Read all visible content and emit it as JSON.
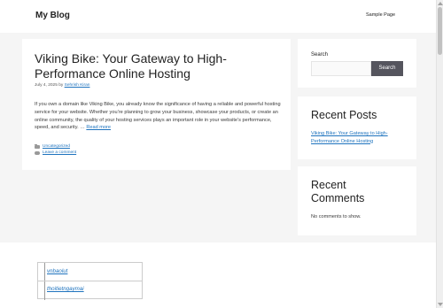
{
  "header": {
    "site_title": "My Blog",
    "nav_items": [
      "Sample Page"
    ]
  },
  "post": {
    "title": "Viking Bike: Your Gateway to High-Performance Online Hosting",
    "date": "July 4, 2025",
    "by": "by",
    "author": "Sehrish Kiran",
    "excerpt": "If you own a domain like Viking Bike, you already know the significance of having a reliable and powerful hosting service for your website. Whether you’re planning to grow your business, showcase your products, or create an online community, the quality of your hosting services plays an important role in your website’s performance, speed, and security. …",
    "read_more": "Read more",
    "category": "Uncategorized",
    "comment_link": "Leave a comment"
  },
  "sidebar": {
    "search_label": "Search",
    "search_value": "",
    "search_button": "Search",
    "recent_posts_title": "Recent Posts",
    "recent_posts": [
      "Viking Bike: Your Gateway to High-Performance Online Hosting"
    ],
    "recent_comments_title": "Recent Comments",
    "no_comments": "No comments to show."
  },
  "footer": {
    "links": [
      "vnbaolut",
      "thoitietngaymai"
    ]
  },
  "icons": {
    "category": "folder-icon",
    "comments": "comment-icon"
  },
  "colors": {
    "link": "#1e73be",
    "search_button_bg": "#55555e",
    "page_bg": "#f5f5f5"
  }
}
